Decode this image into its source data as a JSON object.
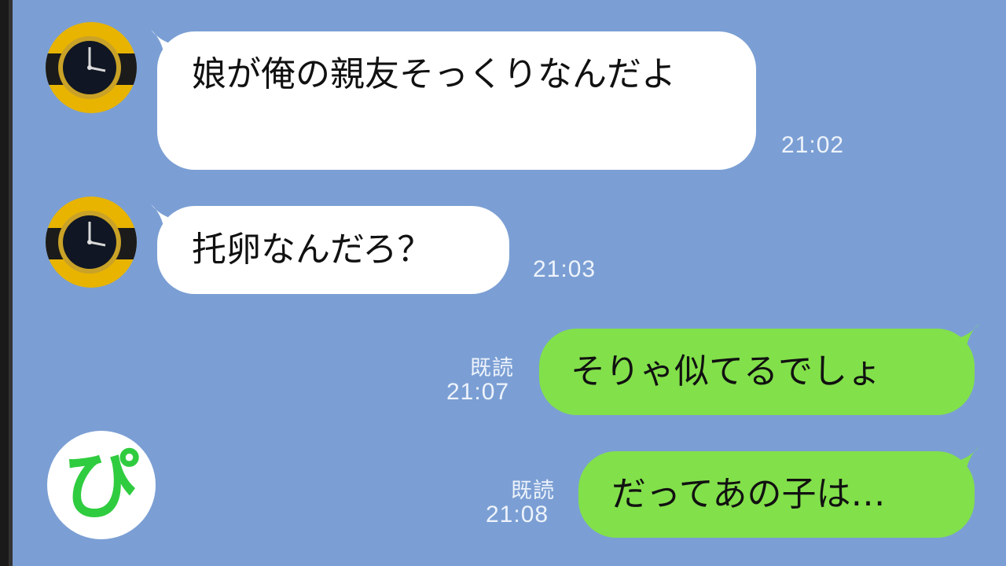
{
  "messages": [
    {
      "side": "incoming",
      "text": "娘が俺の親友そっくりなんだよ",
      "time": "21:02"
    },
    {
      "side": "incoming",
      "text": "托卵なんだろ？",
      "time": "21:03"
    },
    {
      "side": "outgoing",
      "text": "そりゃ似てるでしょ",
      "read": "既読",
      "time": "21:07"
    },
    {
      "side": "outgoing",
      "text": "だってあの子は…",
      "read": "既読",
      "time": "21:08"
    }
  ],
  "logo": {
    "text": "ぴ",
    "color": "#2fcc3f"
  },
  "colors": {
    "background": "#7b9fd4",
    "incoming_bubble": "#ffffff",
    "outgoing_bubble": "#82e04a"
  },
  "icons": {
    "avatar": "wristwatch-avatar-icon"
  }
}
